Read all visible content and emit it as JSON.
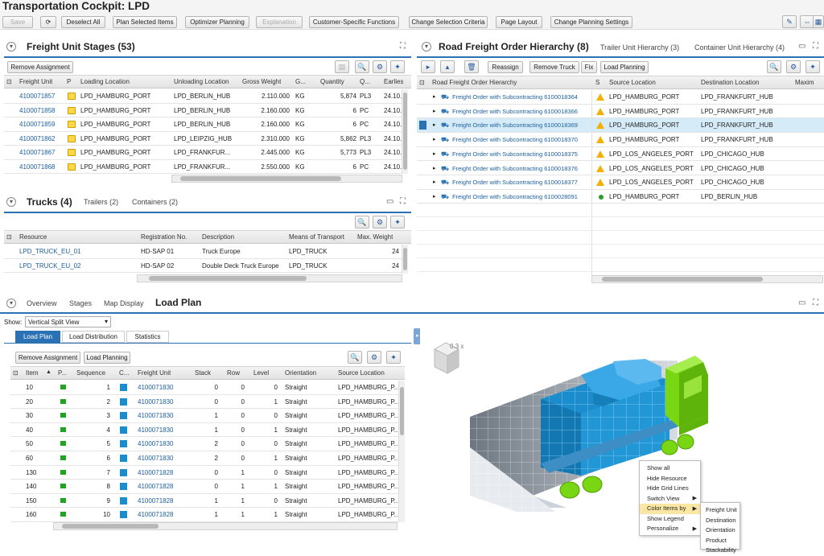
{
  "app": {
    "title": "Transportation Cockpit: LPD"
  },
  "toolbar": {
    "save": "Save",
    "refresh": "⟳",
    "deselect_all": "Deselect All",
    "plan_selected": "Plan Selected Items",
    "optimizer": "Optimizer Planning",
    "explanation": "Explanation",
    "customer_functions": "Customer-Specific Functions",
    "change_criteria": "Change Selection Criteria",
    "page_layout": "Page Layout",
    "change_planning": "Change Planning Settings"
  },
  "fu": {
    "title": "Freight Unit Stages (53)",
    "remove": "Remove Assignment",
    "cols": [
      "Freight Unit",
      "P",
      "Loading Location",
      "Unloading Location",
      "Gross Weight",
      "G...",
      "Quantity",
      "Q...",
      "Earlies"
    ],
    "rows": [
      [
        "4100071857",
        "LPD_HAMBURG_PORT",
        "LPD_BERLIN_HUB",
        "2.110.000",
        "KG",
        "5,874",
        "PL3",
        "24.10."
      ],
      [
        "4100071858",
        "LPD_HAMBURG_PORT",
        "LPD_BERLIN_HUB",
        "2.160.000",
        "KG",
        "6",
        "PC",
        "24.10."
      ],
      [
        "4100071859",
        "LPD_HAMBURG_PORT",
        "LPD_BERLIN_HUB",
        "2.160.000",
        "KG",
        "6",
        "PC",
        "24.10."
      ],
      [
        "4100071862",
        "LPD_HAMBURG_PORT",
        "LPD_LEIPZIG_HUB",
        "2.310.000",
        "KG",
        "5,862",
        "PL3",
        "24.10."
      ],
      [
        "4100071867",
        "LPD_HAMBURG_PORT",
        "LPD_FRANKFUR...",
        "2.445.000",
        "KG",
        "5,773",
        "PL3",
        "24.10."
      ],
      [
        "4100071868",
        "LPD_HAMBURG_PORT",
        "LPD_FRANKFUR...",
        "2.550.000",
        "KG",
        "6",
        "PC",
        "24.10."
      ]
    ]
  },
  "trucks": {
    "title": "Trucks (4)",
    "tab_trailers": "Trailers (2)",
    "tab_containers": "Containers (2)",
    "cols": [
      "Resource",
      "Registration No.",
      "Description",
      "Means of Transport",
      "Max. Weight"
    ],
    "rows": [
      [
        "LPD_TRUCK_EU_01",
        "HD-SAP 01",
        "Truck Europe",
        "LPD_TRUCK",
        "24"
      ],
      [
        "LPD_TRUCK_EU_02",
        "HD-SAP 02",
        "Double Deck Truck Europe",
        "LPD_TRUCK",
        "24"
      ]
    ]
  },
  "rfo": {
    "title": "Road Freight Order Hierarchy (8)",
    "tab_trailer": "Trailer Unit Hierarchy (3)",
    "tab_container": "Container Unit Hierarchy (4)",
    "reassign": "Reassign",
    "remove_truck": "Remove Truck",
    "fix": "Fix",
    "load_planning": "Load Planning",
    "cols": [
      "Road Freight Order Hierarchy",
      "S",
      "Source Location",
      "Destination Location",
      "Maxim"
    ],
    "rows": [
      [
        "Freight Order with Subcontracting 6100018364",
        "LPD_HAMBURG_PORT",
        "LPD_FRANKFURT_HUB",
        "warn"
      ],
      [
        "Freight Order with Subcontracting 6100018366",
        "LPD_HAMBURG_PORT",
        "LPD_FRANKFURT_HUB",
        "warn"
      ],
      [
        "Freight Order with Subcontracting 6100018369",
        "LPD_HAMBURG_PORT",
        "LPD_FRANKFURT_HUB",
        "warn"
      ],
      [
        "Freight Order with Subcontracting 6100018370",
        "LPD_HAMBURG_PORT",
        "LPD_FRANKFURT_HUB",
        "warn"
      ],
      [
        "Freight Order with Subcontracting 6100018375",
        "LPD_LOS_ANGELES_PORT",
        "LPD_CHICAGO_HUB",
        "warn"
      ],
      [
        "Freight Order with Subcontracting 6100018376",
        "LPD_LOS_ANGELES_PORT",
        "LPD_CHICAGO_HUB",
        "warn"
      ],
      [
        "Freight Order with Subcontracting 6100018377",
        "LPD_LOS_ANGELES_PORT",
        "LPD_CHICAGO_HUB",
        "warn"
      ],
      [
        "Freight Order with Subcontracting 6100028091",
        "LPD_HAMBURG_PORT",
        "LPD_BERLIN_HUB",
        "ok"
      ]
    ]
  },
  "bottom": {
    "tab_overview": "Overview",
    "tab_stages": "Stages",
    "tab_map": "Map Display",
    "tab_loadplan": "Load Plan",
    "show_label": "Show:",
    "show_value": "Vertical Split View",
    "sub_loadplan": "Load Plan",
    "sub_distribution": "Load Distribution",
    "sub_statistics": "Statistics",
    "remove": "Remove Assignment",
    "load_planning": "Load Planning",
    "cols": [
      "Item",
      "P...",
      "Sequence",
      "C...",
      "Freight Unit",
      "Stack",
      "Row",
      "Level",
      "Orientation",
      "Source Location"
    ],
    "rows": [
      [
        "10",
        "1",
        "4100071830",
        "0",
        "0",
        "0",
        "Straight",
        "LPD_HAMBURG_P..."
      ],
      [
        "20",
        "2",
        "4100071830",
        "0",
        "0",
        "1",
        "Straight",
        "LPD_HAMBURG_P..."
      ],
      [
        "30",
        "3",
        "4100071830",
        "1",
        "0",
        "0",
        "Straight",
        "LPD_HAMBURG_P..."
      ],
      [
        "40",
        "4",
        "4100071830",
        "1",
        "0",
        "1",
        "Straight",
        "LPD_HAMBURG_P..."
      ],
      [
        "50",
        "5",
        "4100071830",
        "2",
        "0",
        "0",
        "Straight",
        "LPD_HAMBURG_P..."
      ],
      [
        "60",
        "6",
        "4100071830",
        "2",
        "0",
        "1",
        "Straight",
        "LPD_HAMBURG_P..."
      ],
      [
        "130",
        "7",
        "4100071828",
        "0",
        "1",
        "0",
        "Straight",
        "LPD_HAMBURG_P..."
      ],
      [
        "140",
        "8",
        "4100071828",
        "0",
        "1",
        "1",
        "Straight",
        "LPD_HAMBURG_P..."
      ],
      [
        "150",
        "9",
        "4100071828",
        "1",
        "1",
        "0",
        "Straight",
        "LPD_HAMBURG_P..."
      ],
      [
        "160",
        "10",
        "4100071828",
        "1",
        "1",
        "1",
        "Straight",
        "LPD_HAMBURG_P..."
      ]
    ]
  },
  "viewer": {
    "zoom": "0.3 x",
    "menu": [
      "Show all",
      "Hide Resource",
      "Hide Grid Lines",
      "Switch View",
      "Color Items by",
      "Show Legend",
      "Personalize"
    ],
    "submenu": [
      "Freight Unit",
      "Destination",
      "Orientation",
      "Product",
      "Stackability"
    ]
  },
  "colors": {
    "accent": "#2b72b4",
    "link": "#1a5e9e",
    "cargo": "#1b8ccc",
    "truck": "#79d613",
    "highlight": "#d6ebf8"
  }
}
